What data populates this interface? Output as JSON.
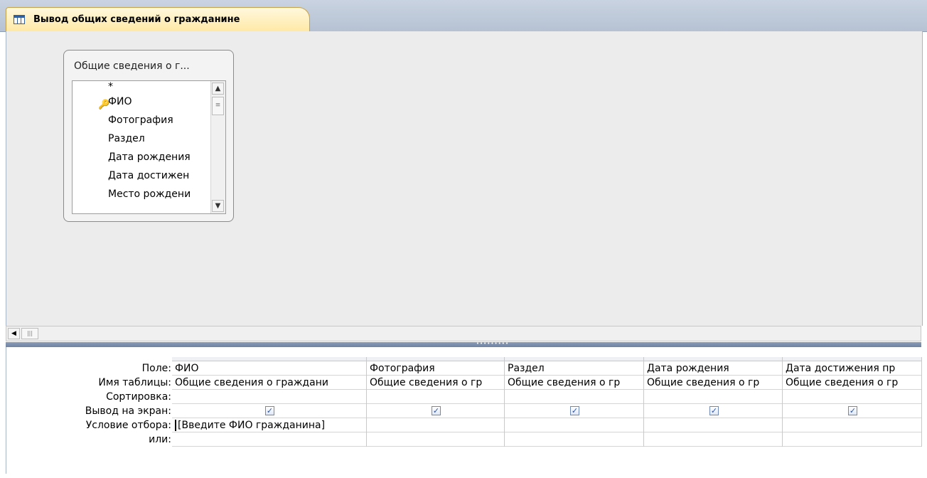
{
  "tab": {
    "title": "Вывод общих сведений о гражданине",
    "icon": "query-table-icon"
  },
  "field_list": {
    "title": "Общие сведения о г...",
    "fields": [
      "*",
      "ФИО",
      "Фотография",
      "Раздел",
      "Дата рождения",
      "Дата достижен",
      "Место рождени"
    ],
    "key_field": "ФИО"
  },
  "grid": {
    "row_labels": [
      "Поле:",
      "Имя таблицы:",
      "Сортировка:",
      "Вывод на экран:",
      "Условие отбора:",
      "или:"
    ],
    "columns": [
      {
        "field": "ФИО",
        "table": "Общие сведения о граждани",
        "sort": "",
        "show": true,
        "criteria": "[Введите ФИО гражданина]",
        "or": ""
      },
      {
        "field": "Фотография",
        "table": "Общие сведения о гр",
        "sort": "",
        "show": true,
        "criteria": "",
        "or": ""
      },
      {
        "field": "Раздел",
        "table": "Общие сведения о гр",
        "sort": "",
        "show": true,
        "criteria": "",
        "or": ""
      },
      {
        "field": "Дата рождения",
        "table": "Общие сведения о гр",
        "sort": "",
        "show": true,
        "criteria": "",
        "or": ""
      },
      {
        "field": "Дата достижения пр",
        "table": "Общие сведения о гр",
        "sort": "",
        "show": true,
        "criteria": "",
        "or": ""
      }
    ],
    "checkmark": "✓"
  },
  "colors": {
    "tab_active": "#ffe9a6",
    "splitter": "#7f93b0",
    "check": "#2a54a8"
  }
}
